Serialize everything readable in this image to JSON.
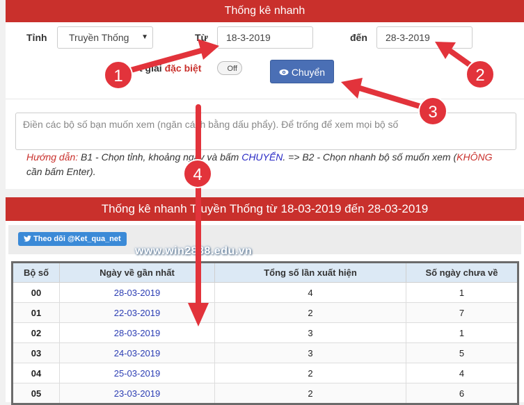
{
  "form": {
    "title": "Thống kê nhanh",
    "province_label": "Tỉnh",
    "province_value": "Truyền Thống",
    "from_label": "Từ",
    "from_value": "18-3-2019",
    "to_label": "đến",
    "to_value": "28-3-2019",
    "special_prefix": "t giải",
    "special_highlight": "đặc biệt",
    "toggle_label": "Off",
    "submit_label": "Chuyển",
    "numbers_placeholder": "Điền các bộ số bạn muốn xem (ngăn cách bằng dấu phẩy). Để trống để xem mọi bộ số",
    "guide": {
      "part1": "Hướng dẫn:",
      "part2": " B1 - Chọn tỉnh, khoảng ngày và bấm ",
      "part3": "CHUYỂN",
      "part4": ". => B2 - Chọn nhanh bộ số muốn xem (",
      "part5": "KHÔNG",
      "part6": " cần bấm Enter)."
    }
  },
  "results": {
    "title": "Thống kê nhanh Truyền Thống từ 18-03-2019 đến 28-03-2019",
    "twitter_label": "Theo dõi @Ket_qua_net",
    "watermark": "www.win2888.edu.vn",
    "columns": [
      "Bộ số",
      "Ngày về gần nhất",
      "Tổng số lần xuất hiện",
      "Số ngày chưa về"
    ],
    "rows": [
      [
        "00",
        "28-03-2019",
        "4",
        "1"
      ],
      [
        "01",
        "22-03-2019",
        "2",
        "7"
      ],
      [
        "02",
        "28-03-2019",
        "3",
        "1"
      ],
      [
        "03",
        "24-03-2019",
        "3",
        "5"
      ],
      [
        "04",
        "25-03-2019",
        "2",
        "4"
      ],
      [
        "05",
        "23-03-2019",
        "2",
        "6"
      ]
    ]
  },
  "annotations": {
    "color": "#e2333b",
    "labels": [
      "1",
      "2",
      "3",
      "4"
    ]
  }
}
